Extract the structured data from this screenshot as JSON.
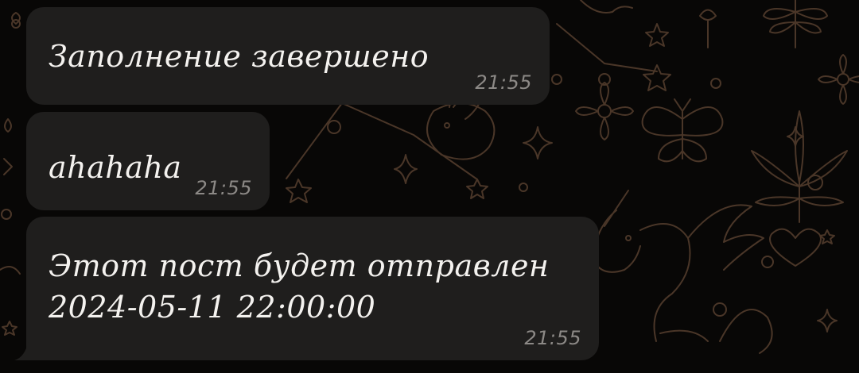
{
  "messages": [
    {
      "text": "Заполнение завершено",
      "time": "21:55"
    },
    {
      "text": "ahahaha",
      "time": "21:55"
    },
    {
      "text": "Этот пост будет отправлен\n2024-05-11 22:00:00",
      "time": "21:55"
    }
  ],
  "colors": {
    "background": "#080706",
    "bubble": "#1f1e1d",
    "message_text": "#f4f2ef",
    "timestamp": "#8c8986",
    "wallpaper_doodle": "#4a3628"
  },
  "wallpaper": {
    "icons": [
      "star-icon",
      "sparkle-icon",
      "flower-icon",
      "butterfly-icon",
      "rabbit-icon",
      "unicorn-icon",
      "heart-icon",
      "leaf-icon",
      "dragonfly-icon"
    ]
  }
}
